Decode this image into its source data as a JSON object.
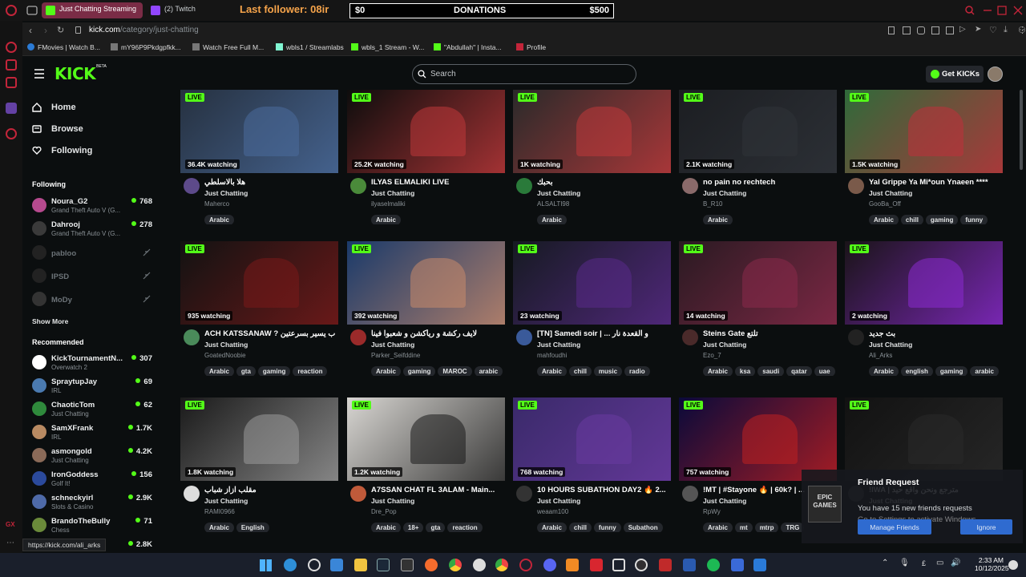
{
  "browser": {
    "tabs": [
      {
        "label": "Just Chatting Streaming",
        "active": true
      },
      {
        "label": "(2) Twitch",
        "active": false
      }
    ],
    "overlay_last_follower": "Last follower: 08ir",
    "donations": {
      "left": "$0",
      "label": "DONATIONS",
      "right": "$500"
    },
    "url_host": "kick.com",
    "url_path": "/category/just-chatting",
    "bookmarks": [
      "FMovies | Watch B...",
      "mY96P9Pkdgpfkk...",
      "Watch Free Full M...",
      "wbls1 / Streamlabs",
      "wbls_1 Stream - W...",
      "\"Abdullah\" | Insta...",
      "Profile"
    ]
  },
  "kick": {
    "logo": "KICK",
    "logo_badge": "BETA",
    "search_placeholder": "Search",
    "get_kicks": "Get KICKs",
    "nav": [
      {
        "label": "Home",
        "icon": "home-icon"
      },
      {
        "label": "Browse",
        "icon": "browse-icon"
      },
      {
        "label": "Following",
        "icon": "heart-icon"
      }
    ],
    "following_title": "Following",
    "following": [
      {
        "name": "Noura_G2",
        "game": "Grand Theft Auto V (G...",
        "viewers": "768",
        "color": "#b64a8e"
      },
      {
        "name": "Dahrooj",
        "game": "Grand Theft Auto V (G...",
        "viewers": "278",
        "color": "#3a3a3a"
      },
      {
        "name": "pabloo",
        "offline": true
      },
      {
        "name": "IPSD",
        "offline": true
      },
      {
        "name": "MoDy",
        "offline": true
      }
    ],
    "show_more": "Show More",
    "recommended_title": "Recommended",
    "recommended": [
      {
        "name": "KickTournamentN...",
        "game": "Overwatch 2",
        "viewers": "307",
        "color": "#ffffff"
      },
      {
        "name": "SpraytupJay",
        "game": "IRL",
        "viewers": "69",
        "color": "#4a7ab0"
      },
      {
        "name": "ChaoticTom",
        "game": "Just Chatting",
        "viewers": "62",
        "color": "#2f8a3c"
      },
      {
        "name": "SamXFrank",
        "game": "IRL",
        "viewers": "1.7K",
        "color": "#b88a62"
      },
      {
        "name": "asmongold",
        "game": "Just Chatting",
        "viewers": "4.2K",
        "color": "#8a6a58"
      },
      {
        "name": "IronGoddess",
        "game": "Golf It!",
        "viewers": "156",
        "color": "#2b4a9c"
      },
      {
        "name": "schneckyirl",
        "game": "Slots & Casino",
        "viewers": "2.9K",
        "color": "#4e6aa8"
      },
      {
        "name": "BrandoTheBully",
        "game": "Chess",
        "viewers": "71",
        "color": "#6a8a3a"
      },
      {
        "name": "",
        "game": "",
        "viewers": "2.8K",
        "color": "#555"
      }
    ],
    "status_url": "https://kick.com/ali_arks",
    "cards": [
      {
        "watching": "36.4K watching",
        "title": "هلا بالاسلطي",
        "category": "Just Chatting",
        "user": "Maherco",
        "tags": [
          "Arabic"
        ],
        "thumb": "#263140",
        "accent": "#4a6b9c",
        "av": "#5d4a8a"
      },
      {
        "watching": "25.2K watching",
        "title": "ILYAS ELMALIKI LIVE",
        "category": "Just Chatting",
        "user": "ilyaselmaliki",
        "tags": [
          "Arabic"
        ],
        "thumb": "#0d0d0d",
        "accent": "#c0393b",
        "av": "#4a8a3a"
      },
      {
        "watching": "1K watching",
        "title": "بحبك",
        "category": "Just Chatting",
        "user": "ALSALTI98",
        "tags": [
          "Arabic"
        ],
        "thumb": "#2a2a2a",
        "accent": "#c0393b",
        "av": "#2a7a3a"
      },
      {
        "watching": "2.1K watching",
        "title": "no pain no rechtech",
        "category": "Just Chatting",
        "user": "B_R10",
        "tags": [
          "Arabic"
        ],
        "thumb": "#1c1e22",
        "accent": "#2f3339",
        "av": "#8a6a6a"
      },
      {
        "watching": "1.5K watching",
        "title": "Yal Grippe Ya Mi*oun Ynaeen ****",
        "category": "Just Chatting",
        "user": "GooBa_Off",
        "tags": [
          "Arabic",
          "chill",
          "gaming",
          "funny"
        ],
        "thumb": "#2f6a3a",
        "accent": "#c02f3a",
        "av": "#7a5a4a"
      },
      {
        "watching": "935 watching",
        "title": "ACH KATSSANAW ? ب يسير بسرعتين",
        "category": "Just Chatting",
        "user": "GoatedNoobie",
        "tags": [
          "Arabic",
          "gta",
          "gaming",
          "reaction"
        ],
        "thumb": "#121212",
        "accent": "#7a1a1a",
        "av": "#4a8a5a"
      },
      {
        "watching": "392 watching",
        "title": "لايف ركشة و ريأكشن و شعبوا فينا",
        "category": "Just Chatting",
        "user": "Parker_Seifddine",
        "tags": [
          "Arabic",
          "gaming",
          "MAROC",
          "arabic"
        ],
        "thumb": "#1a3a6a",
        "accent": "#c98a6a",
        "av": "#9a2a2a"
      },
      {
        "watching": "23 watching",
        "title": "[TN] Samedi soir | ... و القعدة نار",
        "category": "Just Chatting",
        "user": "mahfoudhi",
        "tags": [
          "Arabic",
          "chill",
          "music",
          "radio"
        ],
        "thumb": "#161a22",
        "accent": "#5a2a8a",
        "av": "#3a5a9a"
      },
      {
        "watching": "14 watching",
        "title": "Steins Gate تلتع",
        "category": "Just Chatting",
        "user": "Ezo_7",
        "tags": [
          "Arabic",
          "ksa",
          "saudi",
          "qatar",
          "uae"
        ],
        "thumb": "#2a1a22",
        "accent": "#8a2a4a",
        "av": "#4a2a2a"
      },
      {
        "watching": "2 watching",
        "title": "بث جديد",
        "category": "Just Chatting",
        "user": "Ali_Arks",
        "tags": [
          "Arabic",
          "english",
          "gaming",
          "arabic"
        ],
        "thumb": "#1a1418",
        "accent": "#8a2ad0",
        "av": "#222"
      },
      {
        "watching": "1.8K watching",
        "title": "مقلب ازاز شباب",
        "category": "Just Chatting",
        "user": "RAMI0966",
        "tags": [
          "Arabic",
          "English"
        ],
        "thumb": "#1a1a1a",
        "accent": "#9a9a9a",
        "av": "#ddd"
      },
      {
        "watching": "1.2K watching",
        "title": "A7SSAN CHAT FL 3ALAM - Main...",
        "category": "Just Chatting",
        "user": "Dre_Pop",
        "tags": [
          "Arabic",
          "18+",
          "gta",
          "reaction"
        ],
        "thumb": "#d8d6d2",
        "accent": "#1a1a1a",
        "av": "#c05a3a"
      },
      {
        "watching": "768 watching",
        "title": "10 HOURS SUBATHON DAY2 🔥 2...",
        "category": "Just Chatting",
        "user": "weaam100",
        "tags": [
          "Arabic",
          "chill",
          "funny",
          "Subathon"
        ],
        "thumb": "#3a2a6a",
        "accent": "#6a3aa0",
        "av": "#333"
      },
      {
        "watching": "757 watching",
        "title": "!MT | #Stayone 🔥 | 60k? | ...",
        "category": "Just Chatting",
        "user": "RpWy",
        "tags": [
          "Arabic",
          "mt",
          "mtrp",
          "TRG"
        ],
        "thumb": "#0a0a3a",
        "accent": "#c02020",
        "av": "#555"
      },
      {
        "watching": "",
        "title": "!IWA | مترجع ونحن واقع حيد",
        "category": "Just Chatting",
        "user": "",
        "tags": [],
        "thumb": "#121212",
        "accent": "#2a2a2a",
        "av": "#444"
      }
    ]
  },
  "friend_request": {
    "title": "Friend Request",
    "body": "You have 15 new friends requests",
    "watermark": "Go to Settings to activate Windows.",
    "manage": "Manage Friends",
    "ignore": "Ignore",
    "logo": "EPIC GAMES"
  },
  "taskbar": {
    "time": "2:33 AM",
    "date": "10/12/2025"
  },
  "colors": {
    "kick_green": "#53fc18",
    "background": "#0b0e0f",
    "accent_red": "#c3253a"
  }
}
